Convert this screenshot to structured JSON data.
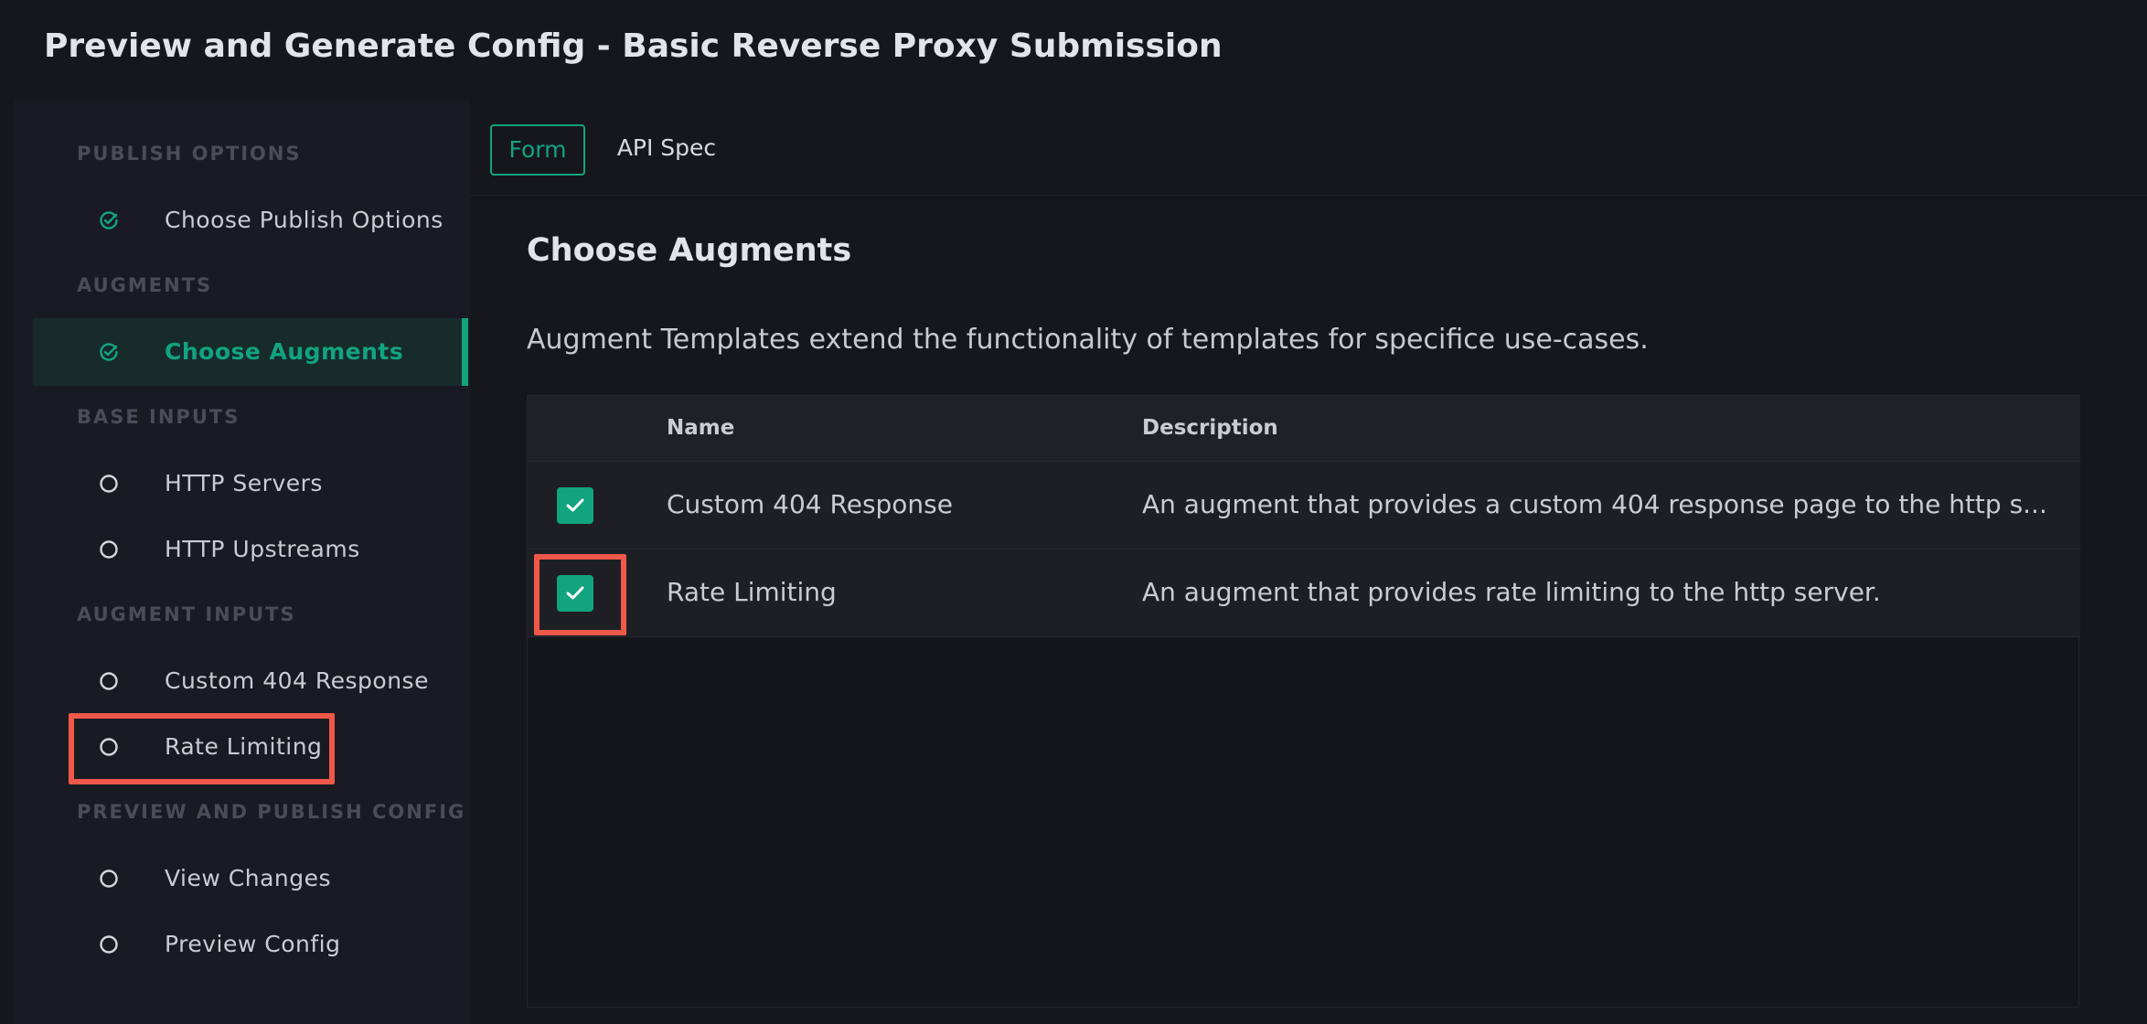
{
  "header": {
    "title": "Preview and Generate Config - Basic Reverse Proxy Submission"
  },
  "sidebar": {
    "sections": [
      {
        "label": "PUBLISH OPTIONS"
      },
      {
        "label": "AUGMENTS"
      },
      {
        "label": "BASE INPUTS"
      },
      {
        "label": "AUGMENT INPUTS"
      },
      {
        "label": "PREVIEW AND PUBLISH CONFIG"
      }
    ],
    "items": [
      {
        "label": "Choose Publish Options",
        "icon": "check-circle-icon",
        "status": "complete"
      },
      {
        "label": "Choose Augments",
        "icon": "check-circle-icon",
        "status": "active"
      },
      {
        "label": "HTTP Servers",
        "icon": "circle-icon",
        "status": "pending"
      },
      {
        "label": "HTTP Upstreams",
        "icon": "circle-icon",
        "status": "pending"
      },
      {
        "label": "Custom 404 Response",
        "icon": "circle-icon",
        "status": "pending"
      },
      {
        "label": "Rate Limiting",
        "icon": "circle-icon",
        "status": "pending"
      },
      {
        "label": "View Changes",
        "icon": "circle-icon",
        "status": "pending"
      },
      {
        "label": "Preview Config",
        "icon": "circle-icon",
        "status": "pending"
      }
    ]
  },
  "tabs": [
    {
      "label": "Form",
      "active": true
    },
    {
      "label": "API Spec",
      "active": false
    }
  ],
  "content": {
    "title": "Choose Augments",
    "description": "Augment Templates extend the functionality of templates for specifice use-cases.",
    "table": {
      "columns": [
        "Name",
        "Description"
      ],
      "rows": [
        {
          "checked": true,
          "name": "Custom 404 Response",
          "description": "An augment that provides a custom 404 response page to the http s..."
        },
        {
          "checked": true,
          "name": "Rate Limiting",
          "description": "An augment that provides rate limiting to the http server."
        }
      ]
    }
  },
  "colors": {
    "accent": "#12a37f",
    "highlight": "#f0584a",
    "background": "#16171d"
  }
}
